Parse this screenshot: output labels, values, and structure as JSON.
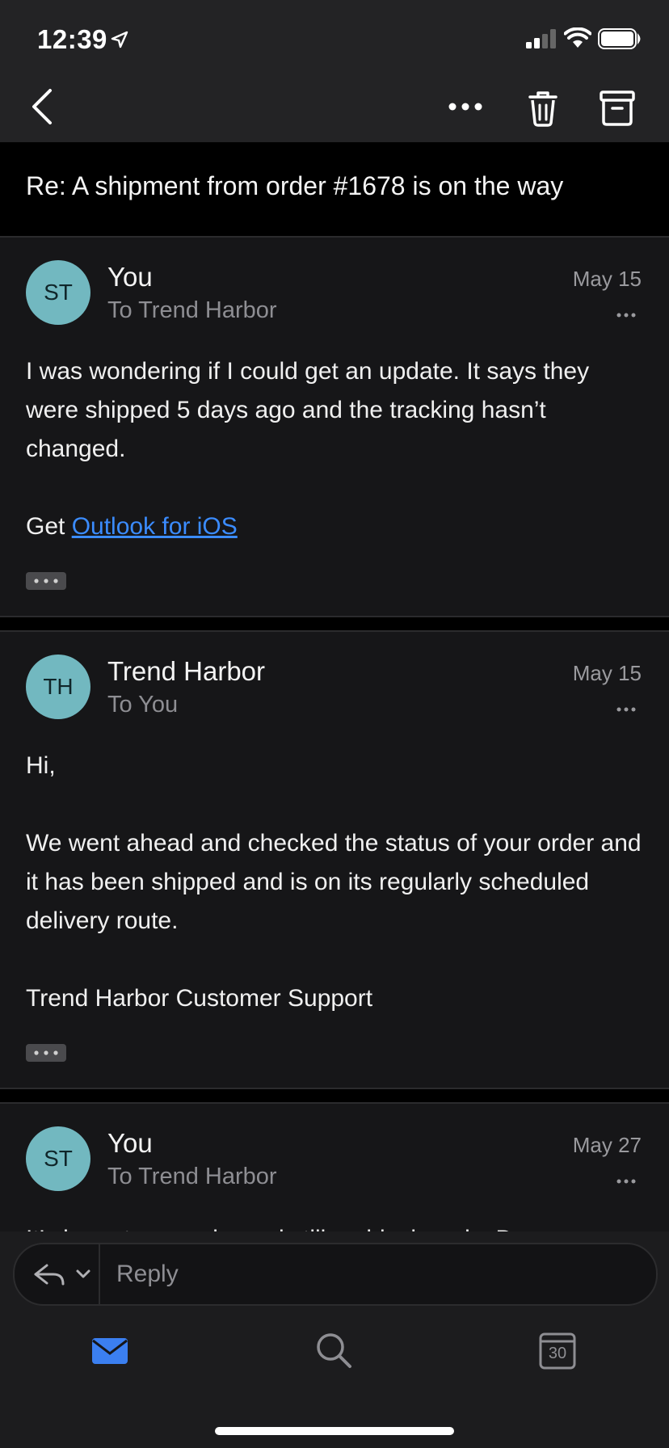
{
  "status_bar": {
    "time": "12:39"
  },
  "subject": "Re: A shipment from order #1678 is on the way",
  "messages": [
    {
      "initials": "ST",
      "sender": "You",
      "recipient": "To Trend Harbor",
      "date": "May 15",
      "body": [
        "I was wondering if I could get an update. It says they were shipped 5 days ago and the tracking hasn’t changed."
      ],
      "signature_prefix": "Get",
      "signature_link": "Outlook for iOS"
    },
    {
      "initials": "TH",
      "sender": "Trend Harbor",
      "recipient": "To You",
      "date": "May 15",
      "body": [
        "Hi,",
        "We went ahead and checked the status of your order and it has been shipped and is on its regularly scheduled delivery route.",
        "Trend Harbor Customer Support"
      ]
    },
    {
      "initials": "ST",
      "sender": "You",
      "recipient": "To Trend Harbor",
      "date": "May 27",
      "body_preview": "It’s been two weeks and still no black pods. Do you"
    }
  ],
  "reply": {
    "placeholder": "Reply"
  },
  "tabs": {
    "calendar_day": "30"
  },
  "colors": {
    "accent": "#3b8cff",
    "avatar": "#72b8c0",
    "background": "#161618"
  }
}
